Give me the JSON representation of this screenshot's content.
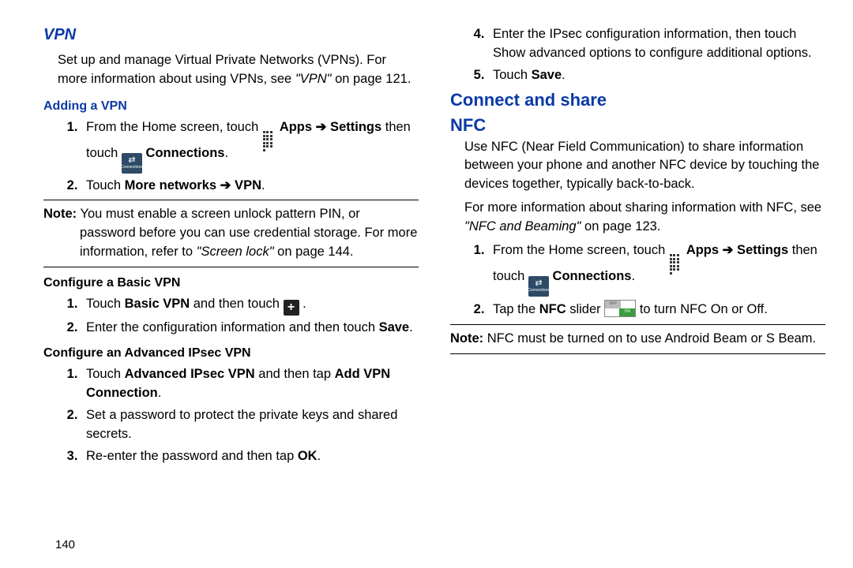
{
  "left": {
    "h_vpn": "VPN",
    "vpn_intro_a": "Set up and manage Virtual Private Networks (VPNs). For more information about using VPNs, see ",
    "vpn_intro_ref": "\"VPN\"",
    "vpn_intro_b": " on page 121.",
    "h_adding": "Adding a VPN",
    "add1_a": "From the Home screen, touch ",
    "add1_b": " Apps ➔ Settings",
    "add1_c": " then touch ",
    "add1_d": " Connections",
    "add2_a": "Touch ",
    "add2_b": "More networks ➔ VPN",
    "note1_label": "Note:",
    "note1_a": " You must enable a screen unlock pattern PIN, or password before you can use credential storage. For more information, refer to ",
    "note1_ref": "\"Screen lock\"",
    "note1_b": "  on page 144.",
    "h_basic": "Configure a Basic VPN",
    "basic1_a": "Touch ",
    "basic1_b": "Basic VPN",
    "basic1_c": " and then touch ",
    "basic2_a": "Enter the configuration information and then touch ",
    "basic2_b": "Save",
    "h_ipsec": "Configure an Advanced IPsec VPN",
    "ip1_a": "Touch ",
    "ip1_b": "Advanced IPsec VPN",
    "ip1_c": " and then tap ",
    "ip1_d": "Add VPN Connection",
    "ip2": "Set a password to protect the private keys and shared secrets.",
    "ip3_a": "Re-enter the password and then tap ",
    "ip3_b": "OK"
  },
  "right": {
    "ip4": "Enter the IPsec configuration information, then touch Show advanced options to configure additional options.",
    "ip5_a": "Touch ",
    "ip5_b": "Save",
    "h_connect": "Connect and share",
    "h_nfc": "NFC",
    "nfc_intro": "Use NFC (Near Field Communication) to share information between your phone and another NFC device by touching the devices together, typically back-to-back.",
    "nfc_more_a": "For more information about sharing information with NFC, see ",
    "nfc_more_ref": "\"NFC and Beaming\"",
    "nfc_more_b": " on page 123.",
    "nfc1_a": "From the Home screen, touch ",
    "nfc1_b": " Apps ➔ Settings",
    "nfc1_c": " then touch ",
    "nfc1_d": " Connections",
    "nfc2_a": "Tap the ",
    "nfc2_b": "NFC",
    "nfc2_c": " slider ",
    "nfc2_d": " to turn NFC On or Off.",
    "note2_label": "Note:",
    "note2": " NFC must be turned on to use Android Beam or S Beam."
  },
  "pagenum": "140"
}
